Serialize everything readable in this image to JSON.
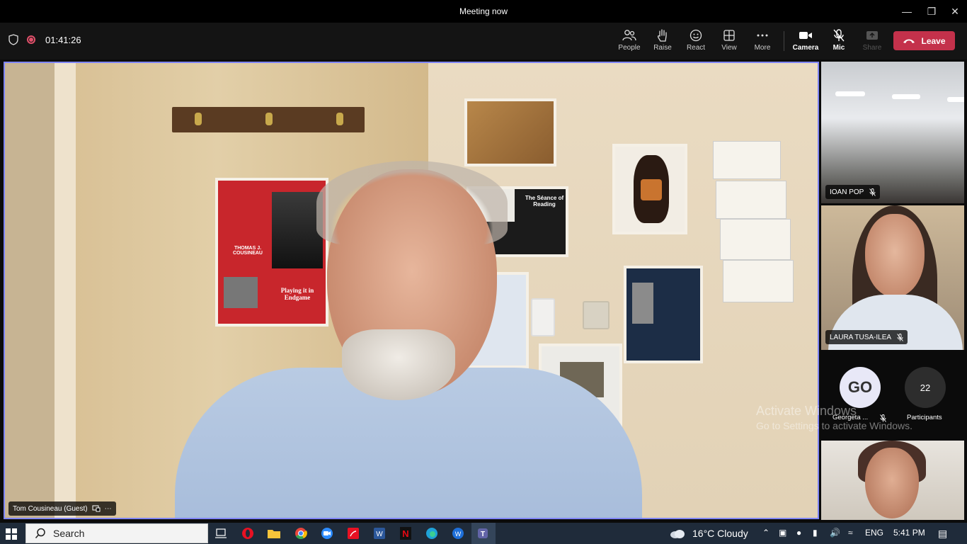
{
  "window": {
    "title": "Meeting now",
    "minimize_icon": "minimize-icon",
    "restore_icon": "restore-icon",
    "close_icon": "close-icon"
  },
  "toolbar": {
    "timer": "01:41:26",
    "buttons": [
      {
        "label": "People",
        "icon": "people-icon"
      },
      {
        "label": "Raise",
        "icon": "hand-icon"
      },
      {
        "label": "React",
        "icon": "smiley-icon"
      },
      {
        "label": "View",
        "icon": "grid-icon"
      },
      {
        "label": "More",
        "icon": "ellipsis-icon"
      },
      {
        "label": "Camera",
        "icon": "camera-icon"
      },
      {
        "label": "Mic",
        "icon": "mic-off-icon"
      },
      {
        "label": "Share",
        "icon": "share-icon"
      }
    ],
    "leave_label": "Leave",
    "leave_color": "#c4314b",
    "accent_color": "#7f85f5"
  },
  "main_video": {
    "participant_name": "Tom Cousineau (Guest)",
    "poster_text": "THOMAS J. COUSINEAU",
    "poster_text2": "Playing it in Endgame",
    "poster_seance": "The Séance of Reading"
  },
  "side_tiles": [
    {
      "name": "IOAN POP",
      "muted": true
    },
    {
      "name": "LAURA TUSA-ILEA",
      "muted": true
    }
  ],
  "avatars": {
    "initials": "GO",
    "initials_name": "Georgeta ...",
    "participants_count": "22",
    "participants_label": "Participants"
  },
  "watermark": {
    "line1": "Activate Windows",
    "line2": "Go to Settings to activate Windows."
  },
  "taskbar": {
    "search_placeholder": "Search",
    "weather": "16°C  Cloudy",
    "language": "ENG",
    "time": "5:41 PM"
  }
}
